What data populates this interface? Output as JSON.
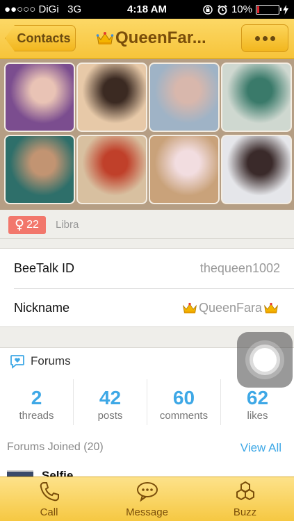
{
  "status_bar": {
    "signal_dots": "●●○○○",
    "carrier": "DiGi",
    "network": "3G",
    "time": "4:18 AM",
    "battery": "10%",
    "battery_level": 0.1
  },
  "nav": {
    "back_label": "Contacts",
    "title": "QueenFar..."
  },
  "photos": [
    {
      "alt": "profile-photo-1",
      "color_a": "#7b4d8f",
      "color_b": "#e9c3b5"
    },
    {
      "alt": "profile-photo-2",
      "color_a": "#e7c9a8",
      "color_b": "#3b2a22"
    },
    {
      "alt": "profile-photo-3",
      "color_a": "#9fb3c6",
      "color_b": "#d8b7ac"
    },
    {
      "alt": "profile-photo-4",
      "color_a": "#cfd8d0",
      "color_b": "#3a7a6a"
    },
    {
      "alt": "profile-photo-5",
      "color_a": "#2e6f6a",
      "color_b": "#c29472"
    },
    {
      "alt": "profile-photo-6",
      "color_a": "#d8c0a0",
      "color_b": "#c0402a"
    },
    {
      "alt": "profile-photo-7",
      "color_a": "#c9a27a",
      "color_b": "#f2dde0"
    },
    {
      "alt": "profile-photo-8",
      "color_a": "#e5e6ea",
      "color_b": "#3a2a2a"
    }
  ],
  "profile": {
    "age": "22",
    "zodiac": "Libra"
  },
  "details": {
    "beetalk_id_label": "BeeTalk ID",
    "beetalk_id_value": "thequeen1002",
    "nickname_label": "Nickname",
    "nickname_value": "QueenFara"
  },
  "forums": {
    "title": "Forums",
    "stats": [
      {
        "value": "2",
        "label": "threads"
      },
      {
        "value": "42",
        "label": "posts"
      },
      {
        "value": "60",
        "label": "comments"
      },
      {
        "value": "62",
        "label": "likes"
      }
    ],
    "joined_label": "Forums Joined",
    "joined_count": "(20)",
    "view_all": "View All",
    "first_forum": "Selfie"
  },
  "tabs": [
    {
      "label": "Call",
      "icon": "phone-icon"
    },
    {
      "label": "Message",
      "icon": "chat-bubble-icon"
    },
    {
      "label": "Buzz",
      "icon": "hexagons-icon"
    }
  ],
  "colors": {
    "accent_yellow": "#f7c43a",
    "link_blue": "#3ea8e6",
    "badge_red": "#f2776c",
    "brown_text": "#7a4e0a"
  }
}
